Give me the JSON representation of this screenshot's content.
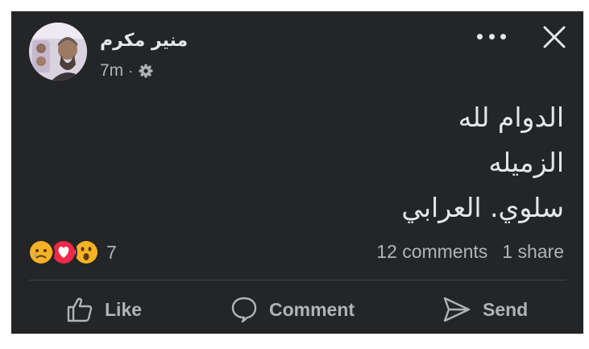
{
  "post": {
    "author": "منير مكرم",
    "time": "7m",
    "separator": "·",
    "privacy_icon": "gear-icon",
    "lines": [
      "الدوام لله",
      "الزميله",
      "سلوي. العرابي"
    ]
  },
  "reactions": {
    "icons": [
      "sad-reaction-icon",
      "love-reaction-icon",
      "wow-reaction-icon"
    ],
    "count": "7"
  },
  "stats": {
    "comments": "12 comments",
    "shares": "1 share"
  },
  "actions": {
    "like": "Like",
    "comment": "Comment",
    "send": "Send"
  },
  "colors": {
    "card_bg": "#242526",
    "text": "#e4e6eb",
    "secondary_text": "#b0b3b8",
    "divider": "#3e4042"
  }
}
